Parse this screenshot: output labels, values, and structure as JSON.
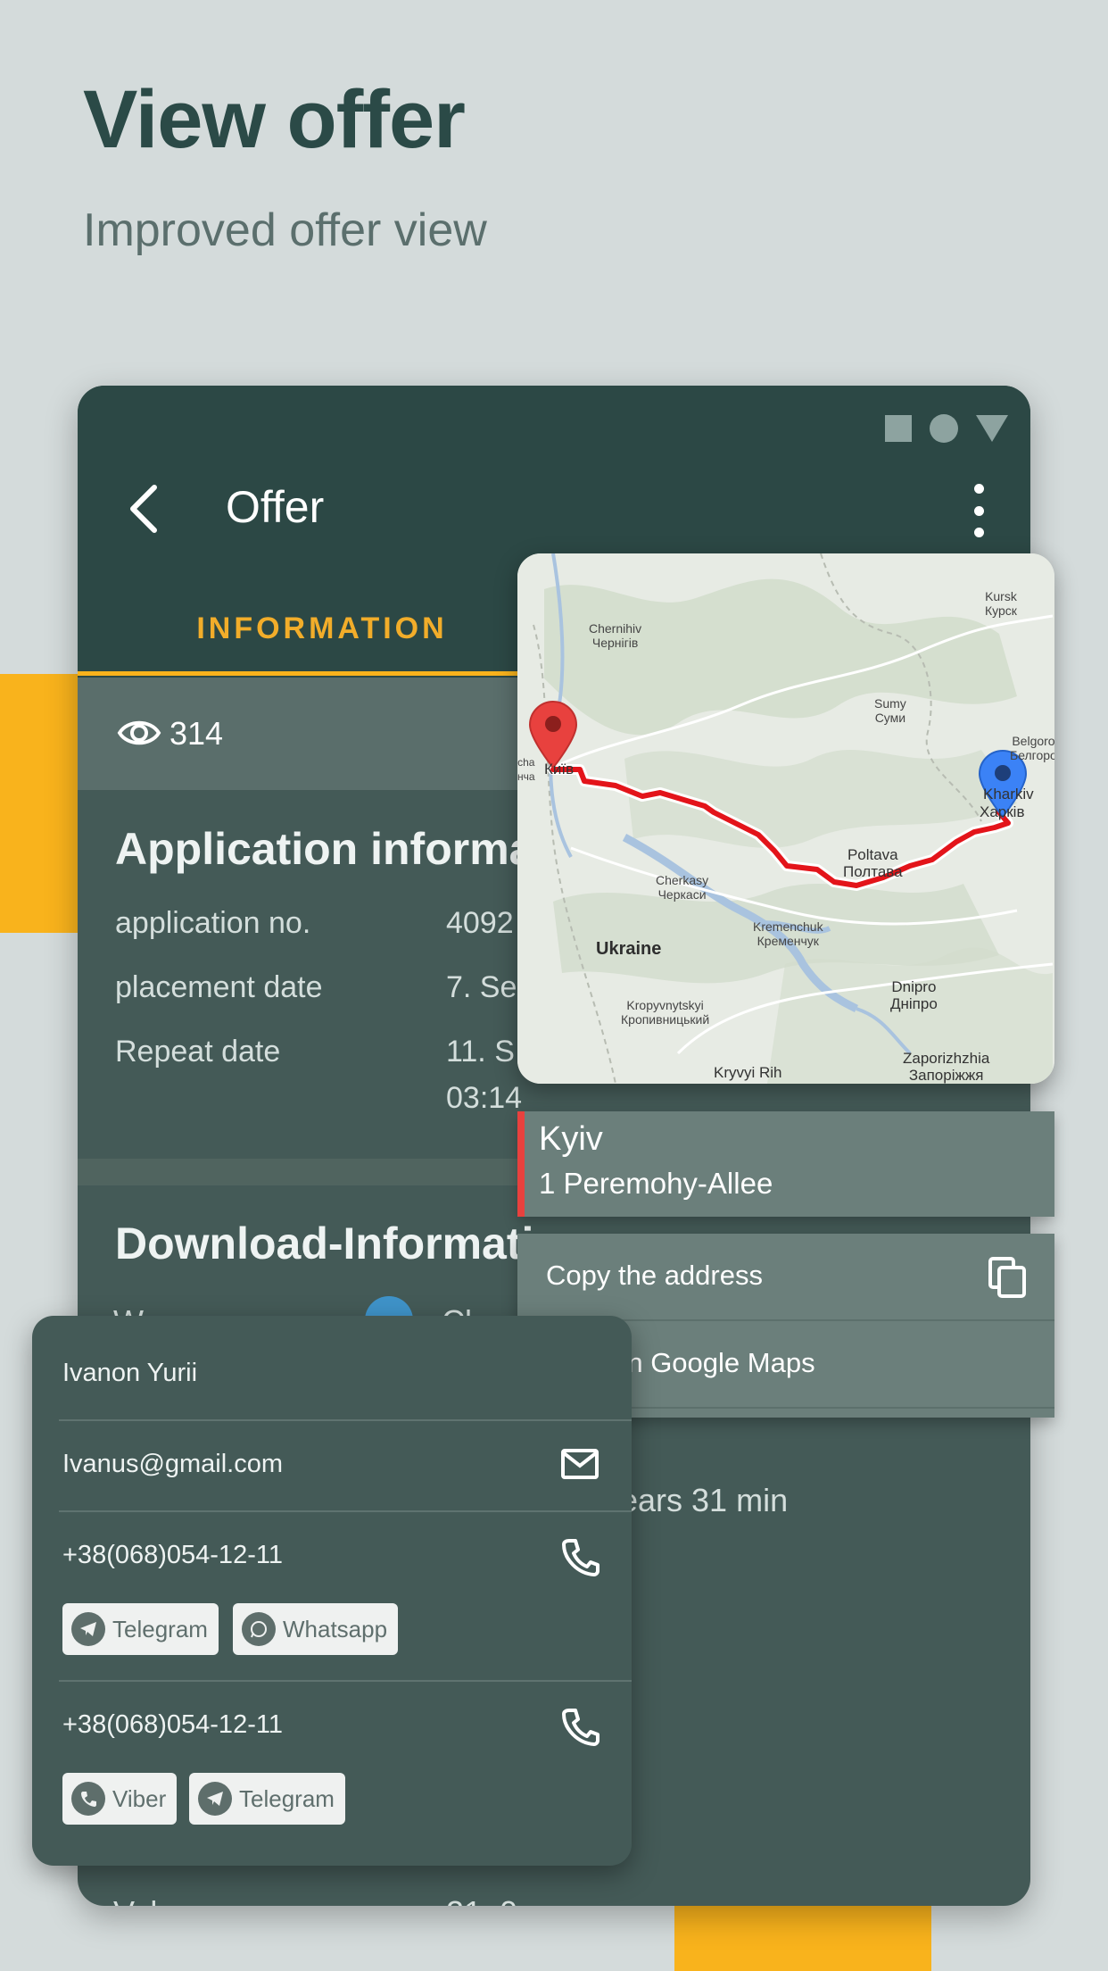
{
  "header": {
    "title": "View offer",
    "subtitle": "Improved offer view"
  },
  "appbar": {
    "title": "Offer",
    "active_tab": "INFORMATION"
  },
  "views": {
    "count": "314"
  },
  "application_section": {
    "title": "Application informa",
    "rows": [
      {
        "label": "application no.",
        "value": "4092"
      },
      {
        "label": "placement date",
        "value": "7. Se"
      },
      {
        "label": "Repeat date",
        "value": "11. S",
        "value2": "03:14"
      }
    ]
  },
  "download_section": {
    "title": "Download-Informati",
    "row_label_partial": "W",
    "row_value_partial": "Cl",
    "duration_partial": "ears 31 min",
    "paren_partial": ")",
    "bottom_label_partial": "Val",
    "bottom_value_partial": "21. 0"
  },
  "map": {
    "labels": {
      "chernihiv": "Chernihiv\nЧернігів",
      "sumy": "Sumy\nСуми",
      "kursk": "Kursk\nКурск",
      "belgorod": "Belgorod\nБелгород",
      "kharkiv": "Харків",
      "kharkiv_partial": "Kharkiv",
      "kyiv_partial": "Київ",
      "cherkasy": "Cherkasy\nЧеркаси",
      "poltava": "Poltava\nПолтава",
      "kremenchuk": "Kremenchuk\nКременчук",
      "ukraine": "Ukraine",
      "kropyvnytskyi": "Kropyvnytskyi\nКропивницький",
      "dnipro": "Dnipro\nДніпро",
      "kryvyi_rih": "Kryvyi Rih",
      "zaporizhzhia": "Zaporizhzhia\nЗапоріжжя",
      "left_edge": "cha\nнча"
    },
    "route_color": "#e3141a",
    "origin_pin_color": "#e8413e",
    "destination_pin_color": "#3b82f6"
  },
  "address": {
    "city": "Kyiv",
    "street": "1 Peremohy-Allee"
  },
  "actions": {
    "copy_label": "Copy the address",
    "maps_label": "Open in Google Maps"
  },
  "contact": {
    "name": "Ivanon Yurii",
    "email": "Ivanus@gmail.com",
    "phones": [
      {
        "number": "+38(068)054-12-11",
        "messengers": [
          "Telegram",
          "Whatsapp"
        ]
      },
      {
        "number": "+38(068)054-12-11",
        "messengers": [
          "Viber",
          "Telegram"
        ]
      }
    ]
  },
  "colors": {
    "background": "#d4dbdb",
    "accent": "#f9b31c",
    "card": "#445a57",
    "appbar": "#2c4845"
  }
}
